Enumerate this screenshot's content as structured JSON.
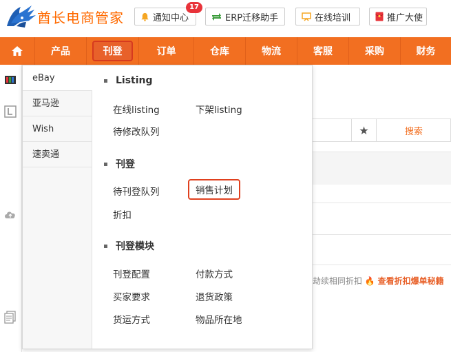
{
  "header": {
    "brand": "酋长电商管家",
    "buttons": [
      {
        "label": "通知中心",
        "icon": "bell-icon",
        "badge": "17"
      },
      {
        "label": "ERP迁移助手",
        "icon": "transfer-arrows-icon"
      },
      {
        "label": "在线培训",
        "icon": "training-screen-icon"
      },
      {
        "label": "推广大使",
        "icon": "red-envelope-icon"
      }
    ]
  },
  "nav": {
    "items": [
      "产品",
      "刊登",
      "订单",
      "仓库",
      "物流",
      "客服",
      "采购",
      "财务"
    ],
    "selected": "刊登"
  },
  "dropdown": {
    "platforms": [
      "eBay",
      "亚马逊",
      "Wish",
      "速卖通"
    ],
    "active_platform": "eBay",
    "sections": [
      {
        "title": "Listing",
        "links": [
          "在线listing",
          "下架listing",
          "待修改队列"
        ]
      },
      {
        "title": "刊登",
        "links": [
          "待刊登队列",
          "销售计划",
          "折扣"
        ]
      },
      {
        "title": "刊登模块",
        "links": [
          "刊登配置",
          "付款方式",
          "买家要求",
          "退货政策",
          "货运方式",
          "物品所在地"
        ]
      }
    ],
    "highlighted_link": "销售计划"
  },
  "background": {
    "search_label": "搜索",
    "promo_text": "劫续相同折扣",
    "promo_link": "查看折扣爆单秘籍"
  }
}
